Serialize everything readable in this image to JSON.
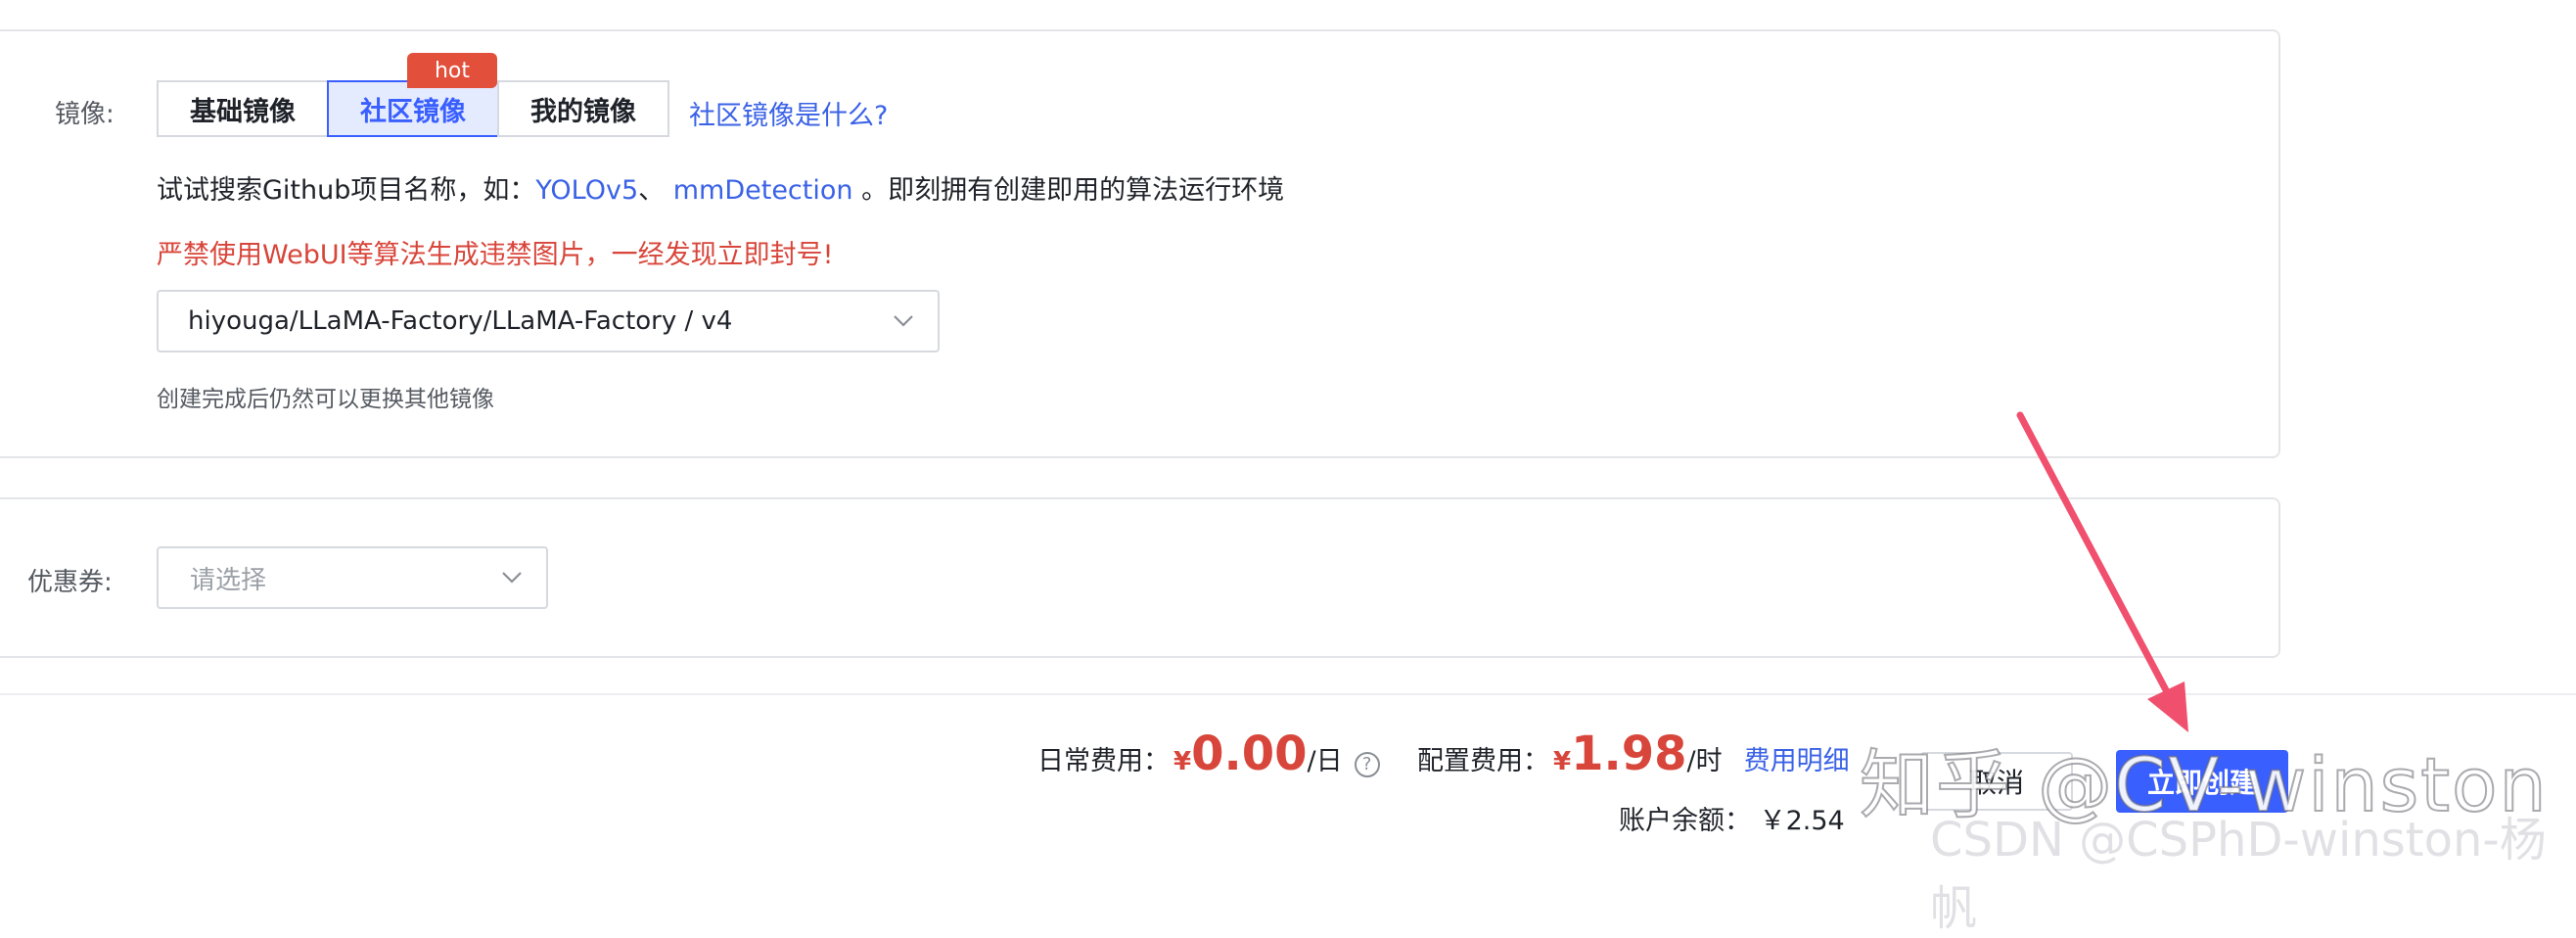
{
  "image_section": {
    "label": "镜像:",
    "tabs": [
      {
        "label": "基础镜像",
        "active": false
      },
      {
        "label": "社区镜像",
        "active": true
      },
      {
        "label": "我的镜像",
        "active": false
      }
    ],
    "hot_badge": "hot",
    "help_link": "社区镜像是什么?",
    "hint_prefix": "试试搜索Github项目名称，如：",
    "hint_link1": "YOLOv5",
    "hint_sep": "、",
    "hint_link2": "mmDetection",
    "hint_suffix": "。即刻拥有创建即用的算法运行环境",
    "warning": "严禁使用WebUI等算法生成违禁图片，一经发现立即封号!",
    "selected_image": "hiyouga/LLaMA-Factory/LLaMA-Factory / v4",
    "note": "创建完成后仍然可以更换其他镜像"
  },
  "coupon_section": {
    "label": "优惠券:",
    "placeholder": "请选择"
  },
  "footer": {
    "daily_label": "日常费用：",
    "currency": "¥",
    "daily_amount": "0.00",
    "daily_unit": "/日",
    "config_label": "配置费用：",
    "config_amount": "1.98",
    "config_unit": "/时",
    "fee_detail_link": "费用明细",
    "balance_label": "账户余额：",
    "balance_value": "￥2.54",
    "cancel_label": "取消",
    "create_label": "立即创建"
  },
  "watermarks": {
    "zhihu": "知乎 @CV-winston",
    "csdn": "CSDN @CSPhD-winston-杨帆"
  },
  "colors": {
    "accent": "#3a5fff",
    "warning": "#d8453a",
    "arrow": "#f0506e"
  }
}
